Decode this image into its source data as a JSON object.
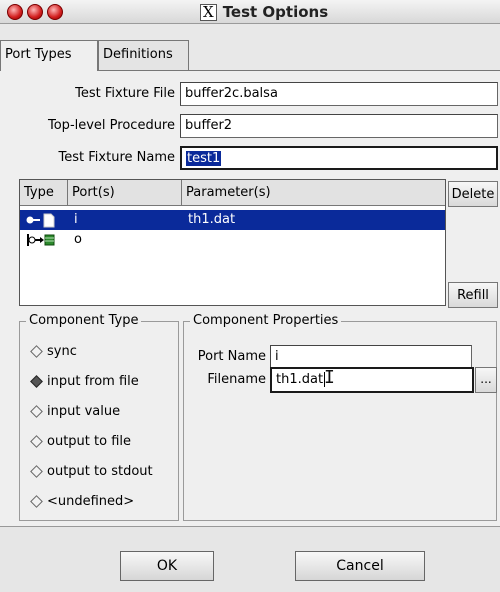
{
  "window": {
    "title": "Test Options",
    "x11_glyph": "X",
    "traffic_lights": [
      "close",
      "minimize",
      "zoom"
    ]
  },
  "tabs": [
    {
      "label": "Port Types",
      "active": true
    },
    {
      "label": "Definitions",
      "active": false
    }
  ],
  "form": {
    "test_fixture_file_label": "Test Fixture File",
    "test_fixture_file_value": "buffer2c.balsa",
    "top_level_procedure_label": "Top-level Procedure",
    "top_level_procedure_value": "buffer2",
    "test_fixture_name_label": "Test Fixture Name",
    "test_fixture_name_value": "test1"
  },
  "ports_table": {
    "headers": [
      "Type",
      "Port(s)",
      "Parameter(s)"
    ],
    "rows": [
      {
        "port": "i",
        "parameter": "th1.dat",
        "selected": true,
        "type_icon": "file-input-icon"
      },
      {
        "port": "o",
        "parameter": "",
        "selected": false,
        "type_icon": "output-port-icon"
      }
    ],
    "delete_label": "Delete",
    "refill_label": "Refill"
  },
  "component_type": {
    "title": "Component Type",
    "options": [
      {
        "label": "sync",
        "selected": false
      },
      {
        "label": "input from file",
        "selected": true
      },
      {
        "label": "input value",
        "selected": false
      },
      {
        "label": "output to file",
        "selected": false
      },
      {
        "label": "output to stdout",
        "selected": false
      },
      {
        "label": "<undefined>",
        "selected": false
      }
    ]
  },
  "component_properties": {
    "title": "Component Properties",
    "port_name_label": "Port Name",
    "port_name_value": "i",
    "filename_label": "Filename",
    "filename_value": "th1.dat",
    "browse_label": "..."
  },
  "buttons": {
    "ok": "OK",
    "cancel": "Cancel"
  },
  "colors": {
    "selection": "#0a2a9a",
    "close_button": "#d11d1d"
  }
}
